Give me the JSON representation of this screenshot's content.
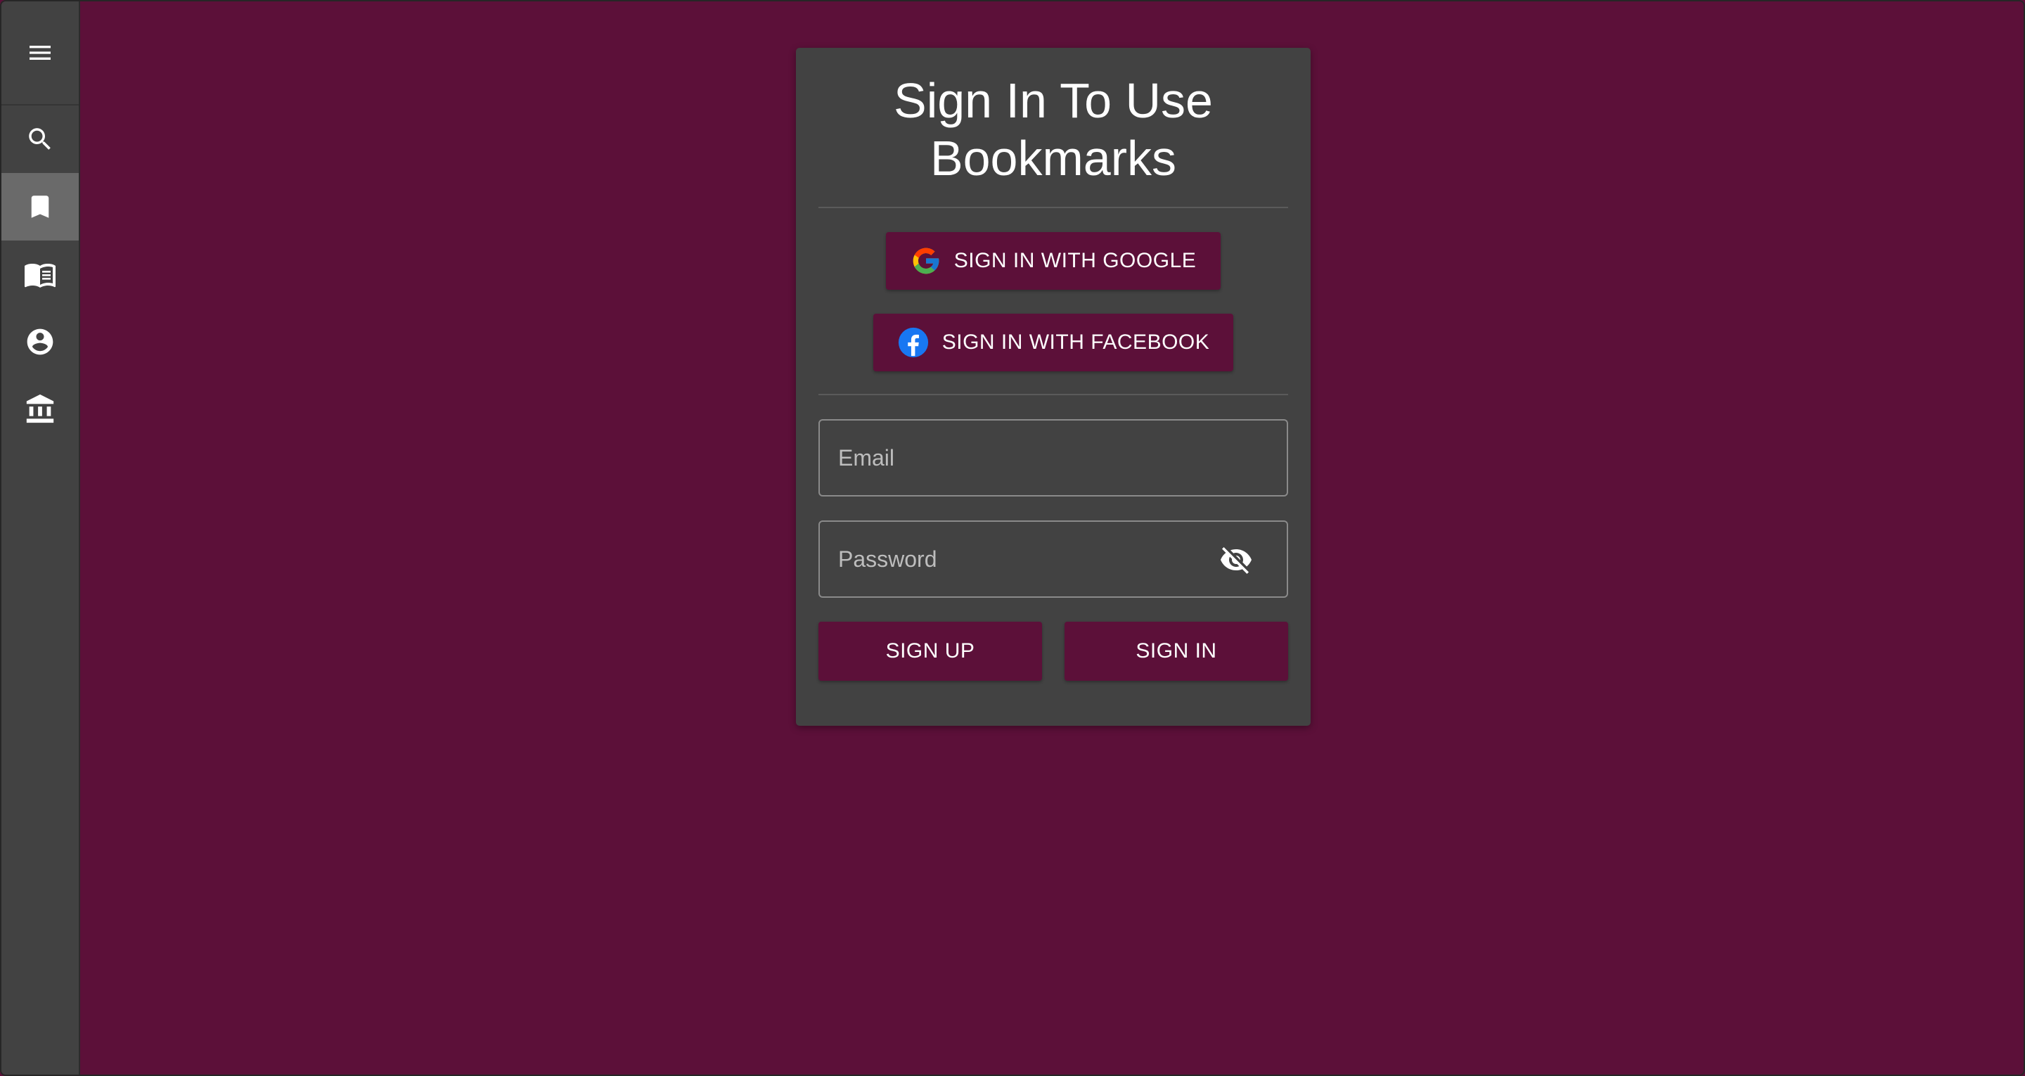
{
  "sidebar": {
    "menu_icon": "menu-icon",
    "items": [
      {
        "name": "search",
        "icon": "search-icon",
        "active": false
      },
      {
        "name": "bookmarks",
        "icon": "bookmark-icon",
        "active": true
      },
      {
        "name": "read",
        "icon": "book-open-icon",
        "active": false
      },
      {
        "name": "account",
        "icon": "account-circle-icon",
        "active": false
      },
      {
        "name": "library",
        "icon": "institution-icon",
        "active": false
      }
    ]
  },
  "card": {
    "title_line1": "Sign In To Use",
    "title_line2": "Bookmarks",
    "google_label": "SIGN IN WITH GOOGLE",
    "facebook_label": "SIGN IN WITH FACEBOOK",
    "email": {
      "placeholder": "Email",
      "value": ""
    },
    "password": {
      "placeholder": "Password",
      "value": "",
      "toggle_icon": "visibility-off-icon"
    },
    "sign_up_label": "SIGN UP",
    "sign_in_label": "SIGN IN"
  },
  "colors": {
    "background": "#5c1039",
    "sidebar": "#424242",
    "card": "#424242",
    "button": "#5c1039",
    "sidebar_active": "#6a6a6a",
    "facebook_blue": "#1877f2"
  }
}
